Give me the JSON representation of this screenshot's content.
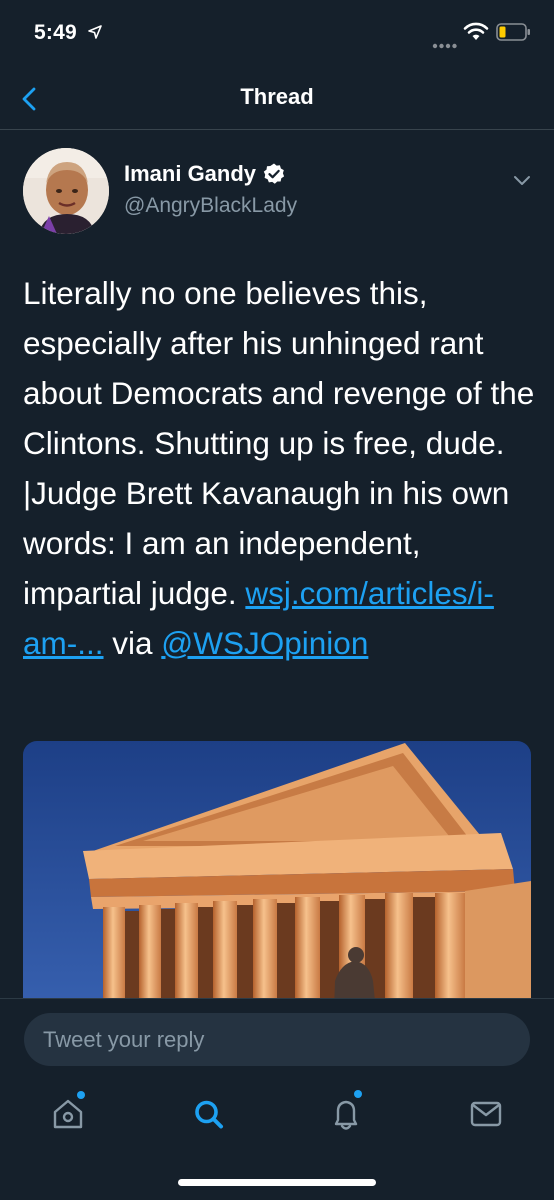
{
  "status_bar": {
    "time": "5:49",
    "location_icon": "location-arrow-icon",
    "signal_icon": "signal-dots-icon",
    "wifi_icon": "wifi-icon",
    "battery_icon": "battery-low-icon",
    "battery_color": "#ffcc00"
  },
  "nav": {
    "title": "Thread",
    "back_icon": "chevron-left-icon"
  },
  "tweet": {
    "author_name": "Imani Gandy",
    "author_handle": "@AngryBlackLady",
    "verified_icon": "verified-badge-icon",
    "menu_icon": "chevron-down-icon",
    "text": "Literally no one believes this, especially after his unhinged rant about Democrats and revenge of the Clintons. Shutting up is free, dude. |Judge Brett Kavanaugh in his own words: I am an independent, impartial judge. ",
    "link": "wsj.com/articles/i-am-...",
    "via_text": " via ",
    "mention": "@WSJOpinion"
  },
  "reply": {
    "placeholder": "Tweet your reply"
  },
  "tab_bar": {
    "items": [
      {
        "name": "home",
        "icon": "home-icon",
        "has_dot": true
      },
      {
        "name": "search",
        "icon": "search-icon",
        "active": true
      },
      {
        "name": "notifications",
        "icon": "bell-icon",
        "has_dot": true
      },
      {
        "name": "messages",
        "icon": "mail-icon"
      }
    ]
  },
  "colors": {
    "background": "#15202b",
    "accent": "#1da1f2",
    "secondary_text": "#8899a6",
    "divider": "#38444d",
    "input_bg": "#253341"
  }
}
